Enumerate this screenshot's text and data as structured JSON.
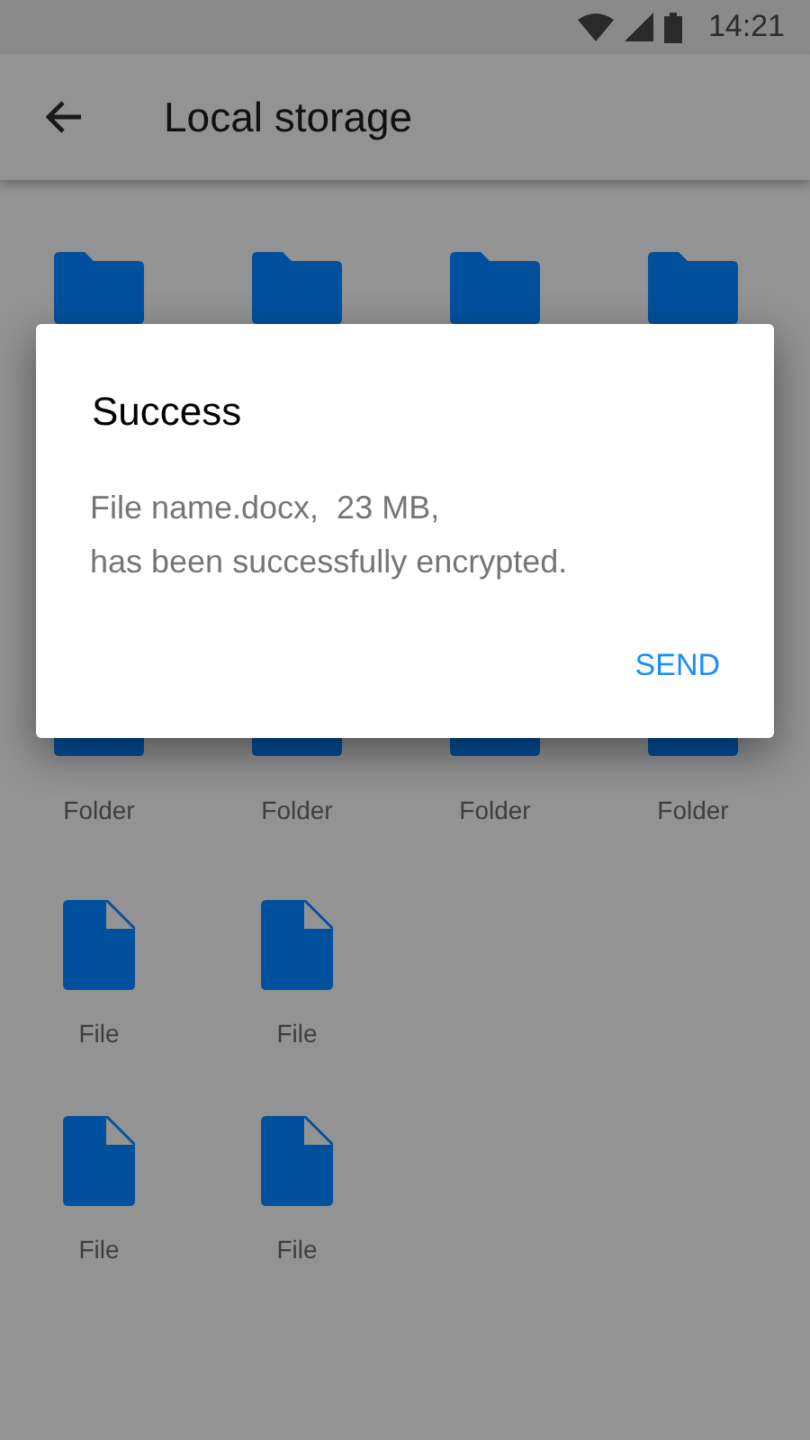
{
  "status_bar": {
    "time": "14:21"
  },
  "app_bar": {
    "title": "Local storage"
  },
  "grid_rows": [
    [
      {
        "kind": "folder"
      },
      {
        "kind": "folder"
      },
      {
        "kind": "folder"
      },
      {
        "kind": "folder"
      }
    ],
    [
      {
        "kind": "folder",
        "label": "Folder"
      },
      {
        "kind": "folder",
        "label": "Folder"
      },
      {
        "kind": "folder",
        "label": "Folder"
      },
      {
        "kind": "folder",
        "label": "Folder"
      }
    ],
    [
      {
        "kind": "file",
        "label": "File"
      },
      {
        "kind": "file",
        "label": "File"
      }
    ],
    [
      {
        "kind": "file",
        "label": "File"
      },
      {
        "kind": "file",
        "label": "File"
      }
    ]
  ],
  "dialog": {
    "title": "Success",
    "message_lines": [
      "File name.docx,  23 MB,",
      "has been successfully encrypted."
    ],
    "buttons": [
      "SEND"
    ]
  }
}
